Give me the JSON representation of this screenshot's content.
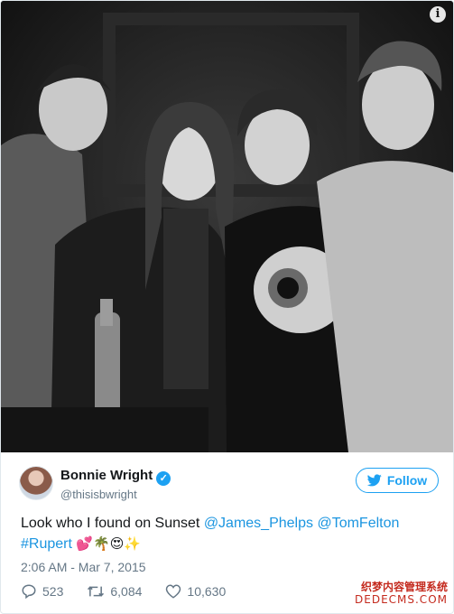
{
  "tweet": {
    "author_name": "Bonnie Wright",
    "author_handle": "@thisisbwright",
    "follow_label": "Follow",
    "text_prefix": "Look who I found on Sunset ",
    "mention_1": "@James_Phelps",
    "mention_2": "@TomFelton",
    "hashtag": "#Rupert",
    "emojis": "💕🌴😍✨",
    "timestamp": "2:06 AM - Mar 7, 2015",
    "reply_count": "523",
    "retweet_count": "6,084",
    "like_count": "10,630"
  },
  "photo": {
    "info_glyph": "i"
  },
  "watermark": {
    "line1": "织梦内容管理系统",
    "line2": "DEDECMS.COM"
  },
  "colors": {
    "accent": "#1da1f2",
    "link": "#1b95e0",
    "muted": "#657786",
    "text": "#14171a"
  },
  "icons": [
    "info-icon",
    "verified-badge-icon",
    "twitter-bird-icon",
    "reply-icon",
    "retweet-icon",
    "heart-icon"
  ]
}
